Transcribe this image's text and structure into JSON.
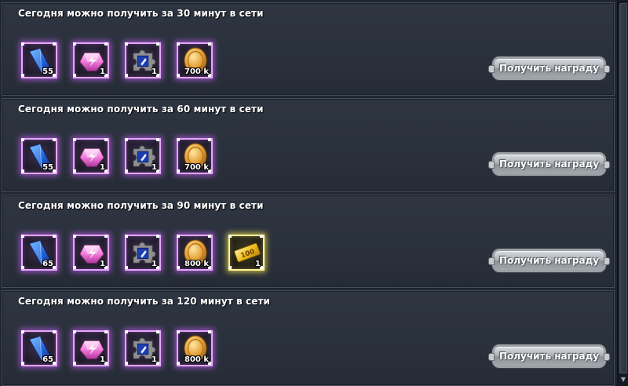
{
  "rewards": [
    {
      "title": "Сегодня можно получить за 30 минут в сети",
      "button": "Получить награду",
      "items": [
        {
          "icon": "blue-crystal-icon",
          "qty": "55"
        },
        {
          "icon": "pink-gem-icon",
          "qty": "1"
        },
        {
          "icon": "puzzle-piece-icon",
          "qty": "1"
        },
        {
          "icon": "gold-coin-icon",
          "qty": "700 k"
        }
      ]
    },
    {
      "title": "Сегодня можно получить за 60 минут в сети",
      "button": "Получить награду",
      "items": [
        {
          "icon": "blue-crystal-icon",
          "qty": "55"
        },
        {
          "icon": "pink-gem-icon",
          "qty": "1"
        },
        {
          "icon": "puzzle-piece-icon",
          "qty": "1"
        },
        {
          "icon": "gold-coin-icon",
          "qty": "700 k"
        }
      ]
    },
    {
      "title": "Сегодня можно получить за 90 минут в сети",
      "button": "Получить награду",
      "items": [
        {
          "icon": "blue-crystal-icon",
          "qty": "65"
        },
        {
          "icon": "pink-gem-icon",
          "qty": "1"
        },
        {
          "icon": "puzzle-piece-icon",
          "qty": "1"
        },
        {
          "icon": "gold-coin-icon",
          "qty": "800 k"
        },
        {
          "icon": "gold-ticket-icon",
          "qty": "1",
          "ticket_text": "100",
          "rarity": "gold"
        }
      ]
    },
    {
      "title": "Сегодня можно получить за 120 минут в сети",
      "button": "Получить награду",
      "items": [
        {
          "icon": "blue-crystal-icon",
          "qty": "65"
        },
        {
          "icon": "pink-gem-icon",
          "qty": "1"
        },
        {
          "icon": "puzzle-piece-icon",
          "qty": "1"
        },
        {
          "icon": "gold-coin-icon",
          "qty": "800 k"
        }
      ]
    }
  ]
}
